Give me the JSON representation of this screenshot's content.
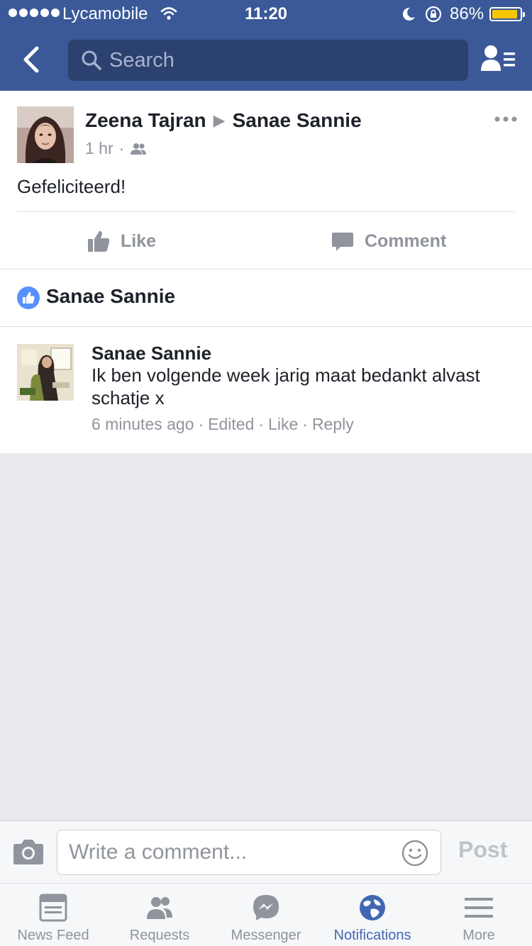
{
  "status_bar": {
    "carrier": "Lycamobile",
    "time": "11:20",
    "battery_percent": "86%",
    "battery_level": 0.86
  },
  "nav": {
    "search_placeholder": "Search"
  },
  "post": {
    "author": "Zeena Tajran",
    "target": "Sanae Sannie",
    "time": "1 hr",
    "text": "Gefeliciteerd!",
    "like_label": "Like",
    "comment_label": "Comment"
  },
  "likes": {
    "names": "Sanae Sannie"
  },
  "comment": {
    "author": "Sanae Sannie",
    "text": "Ik ben volgende week jarig maat bedankt alvast schatje x",
    "time": "6 minutes ago",
    "edited": "Edited",
    "like": "Like",
    "reply": "Reply"
  },
  "composer": {
    "placeholder": "Write a comment...",
    "post_label": "Post"
  },
  "tabs": [
    {
      "label": "News Feed",
      "icon": "news-feed-icon",
      "active": false
    },
    {
      "label": "Requests",
      "icon": "requests-icon",
      "active": false
    },
    {
      "label": "Messenger",
      "icon": "messenger-icon",
      "active": false
    },
    {
      "label": "Notifications",
      "icon": "globe-icon",
      "active": true
    },
    {
      "label": "More",
      "icon": "menu-icon",
      "active": false
    }
  ],
  "colors": {
    "brand": "#3b5998",
    "accent": "#4267b2",
    "muted": "#90949c",
    "battery": "#f6c700",
    "like_badge": "#5890ff"
  }
}
